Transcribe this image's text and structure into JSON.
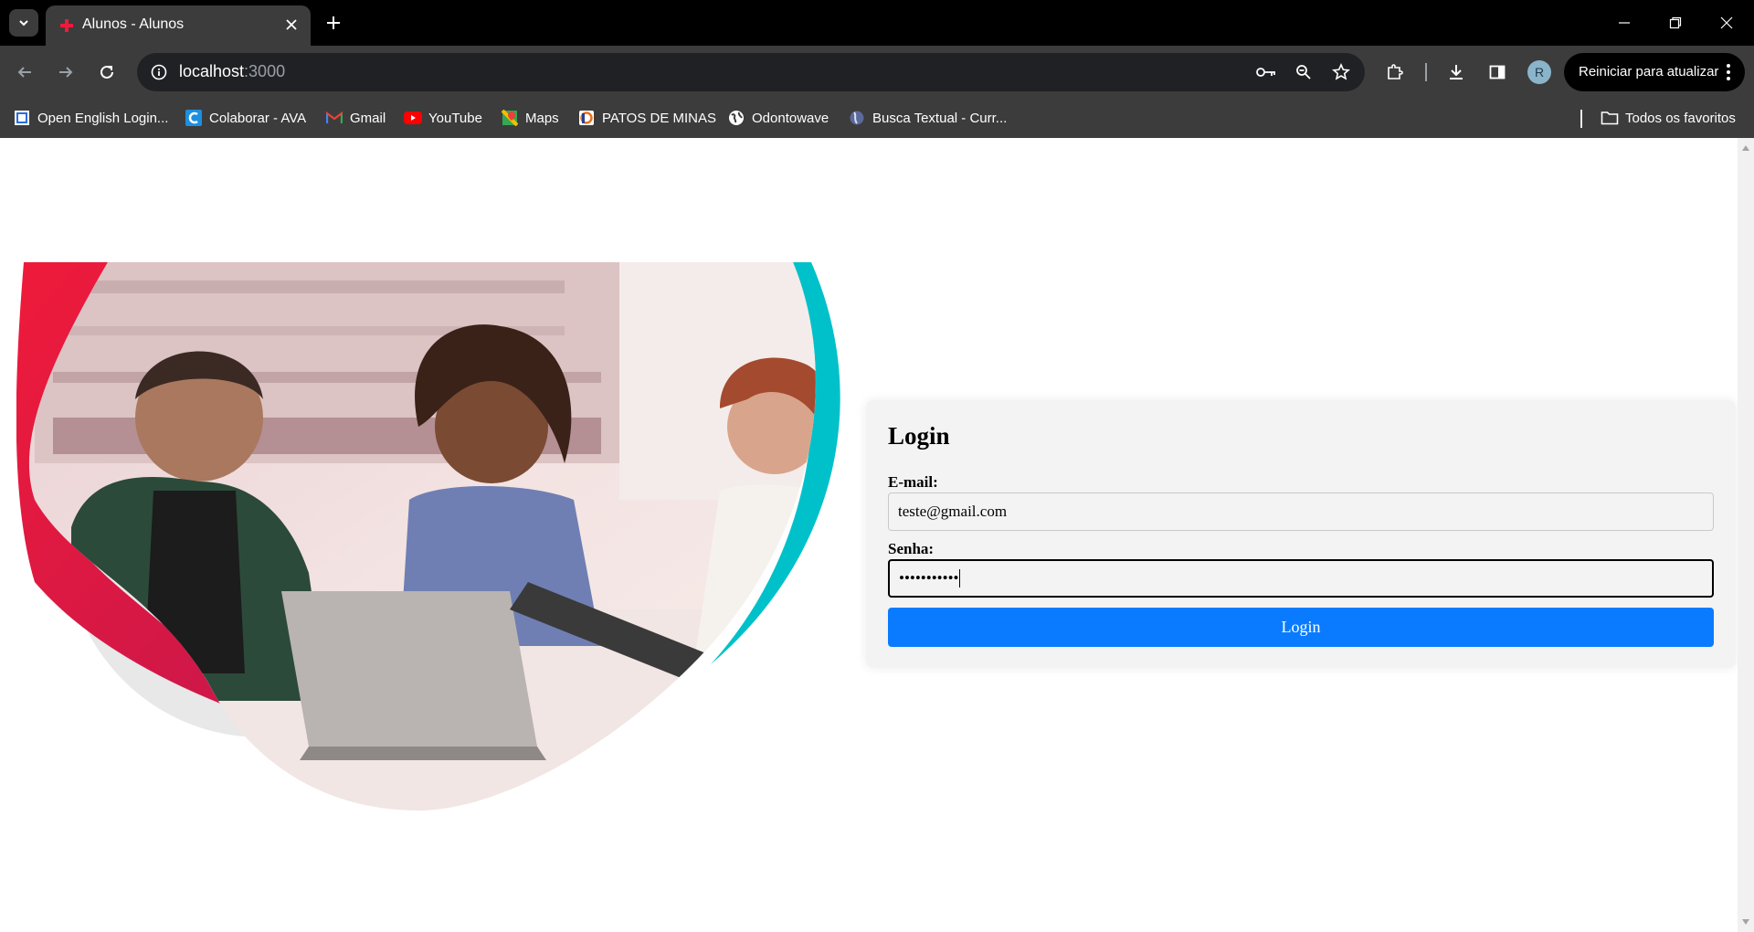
{
  "browser": {
    "tab_title": "Alunos - Alunos",
    "url_host": "localhost",
    "url_port": ":3000",
    "update_button_label": "Reiniciar para atualizar",
    "profile_initial": "R",
    "icons": {
      "tab_list": "chevron-down-icon",
      "tab_favicon": "red-cross-icon",
      "close_tab": "close-icon",
      "new_tab": "plus-icon",
      "back": "arrow-left-icon",
      "forward": "arrow-right-icon",
      "reload": "reload-icon",
      "site_info": "info-icon",
      "password": "key-icon",
      "zoom": "zoom-icon",
      "bookmark_star": "star-icon",
      "extensions": "puzzle-icon",
      "downloads": "download-icon",
      "side_panel": "side-panel-icon",
      "menu": "kebab-menu-icon"
    }
  },
  "bookmarks": {
    "items": [
      {
        "label": "Open English Login...",
        "icon": "open-english-icon"
      },
      {
        "label": "Colaborar - AVA",
        "icon": "colaborar-icon"
      },
      {
        "label": "Gmail",
        "icon": "gmail-icon"
      },
      {
        "label": "YouTube",
        "icon": "youtube-icon"
      },
      {
        "label": "Maps",
        "icon": "maps-icon"
      },
      {
        "label": "PATOS DE MINAS",
        "icon": "patos-icon"
      },
      {
        "label": "Odontowave",
        "icon": "globe-icon"
      },
      {
        "label": "Busca Textual - Curr...",
        "icon": "lattes-icon"
      }
    ],
    "all_bookmarks_label": "Todos os favoritos"
  },
  "colors": {
    "accent_red": "#ef1a3a",
    "accent_teal": "#00c1c9",
    "login_button": "#0a7bff",
    "card_bg": "#f3f3f3"
  },
  "login": {
    "title": "Login",
    "email_label": "E-mail:",
    "email_value": "teste@gmail.com",
    "password_label": "Senha:",
    "password_value": "•••••••••••",
    "button_label": "Login"
  }
}
